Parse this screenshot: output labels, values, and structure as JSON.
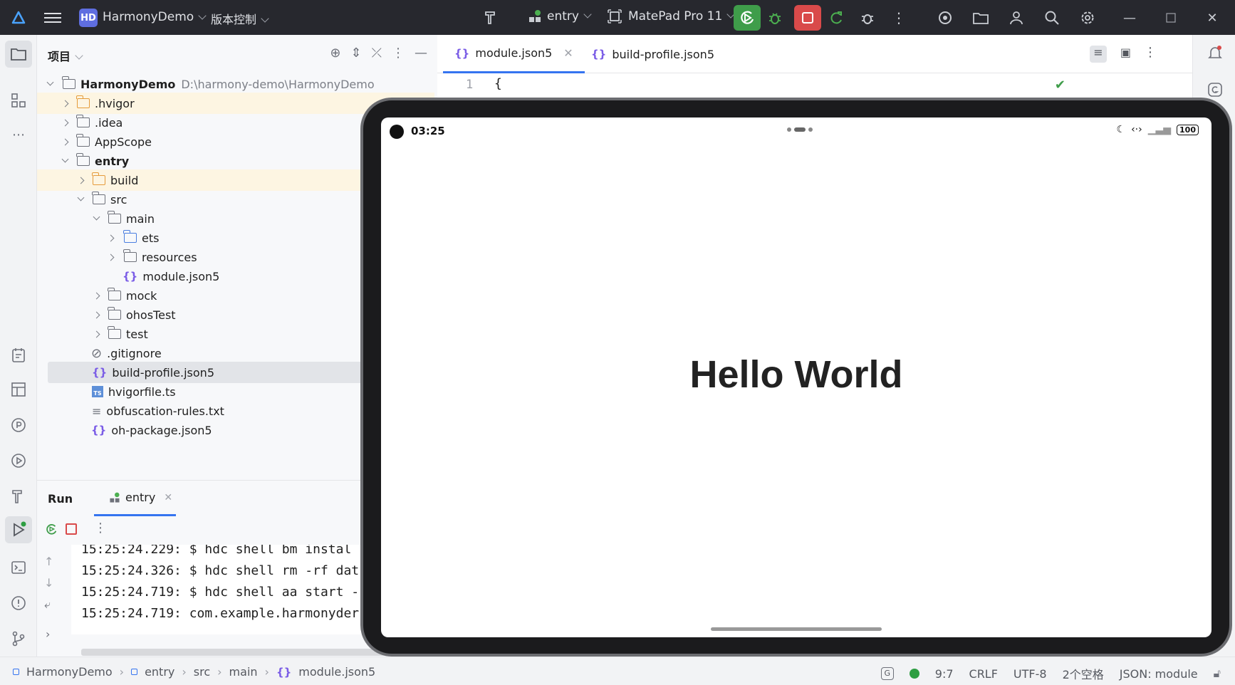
{
  "titlebar": {
    "project_badge": "HD",
    "project_name": "HarmonyDemo",
    "vcs_label": "版本控制",
    "run_config": "entry",
    "device": "MatePad Pro 11"
  },
  "project_panel": {
    "title": "项目",
    "root": {
      "name": "HarmonyDemo",
      "path": "D:\\harmony-demo\\HarmonyDemo"
    },
    "items": [
      {
        "label": ".hvigor"
      },
      {
        "label": ".idea"
      },
      {
        "label": "AppScope"
      },
      {
        "label": "entry"
      },
      {
        "label": "build"
      },
      {
        "label": "src"
      },
      {
        "label": "main"
      },
      {
        "label": "ets"
      },
      {
        "label": "resources"
      },
      {
        "label": "module.json5"
      },
      {
        "label": "mock"
      },
      {
        "label": "ohosTest"
      },
      {
        "label": "test"
      },
      {
        "label": ".gitignore"
      },
      {
        "label": "build-profile.json5"
      },
      {
        "label": "hvigorfile.ts"
      },
      {
        "label": "obfuscation-rules.txt"
      },
      {
        "label": "oh-package.json5"
      }
    ]
  },
  "run_panel": {
    "title": "Run",
    "tab_label": "entry",
    "console_lines": [
      "15:25:24.229: $ hdc shell bm instal",
      "15:25:24.326: $ hdc shell rm -rf dat",
      "15:25:24.719: $ hdc shell aa start -",
      "15:25:24.719: com.example.harmonyder"
    ]
  },
  "editor": {
    "tabs": [
      {
        "label": "module.json5"
      },
      {
        "label": "build-profile.json5"
      }
    ],
    "line_number": "1",
    "line_text": "{"
  },
  "emulator": {
    "time": "03:25",
    "battery": "100",
    "hello_text": "Hello World"
  },
  "statusbar": {
    "breadcrumbs": [
      "HarmonyDemo",
      "entry",
      "src",
      "main",
      "module.json5"
    ],
    "position": "9:7",
    "line_sep": "CRLF",
    "encoding": "UTF-8",
    "indent": "2个空格",
    "file_type": "JSON: module"
  },
  "colors": {
    "accent": "#3574f0",
    "run_green": "#3f9d4a",
    "stop_red": "#d94a4a",
    "titlebar_bg": "#27282e"
  }
}
